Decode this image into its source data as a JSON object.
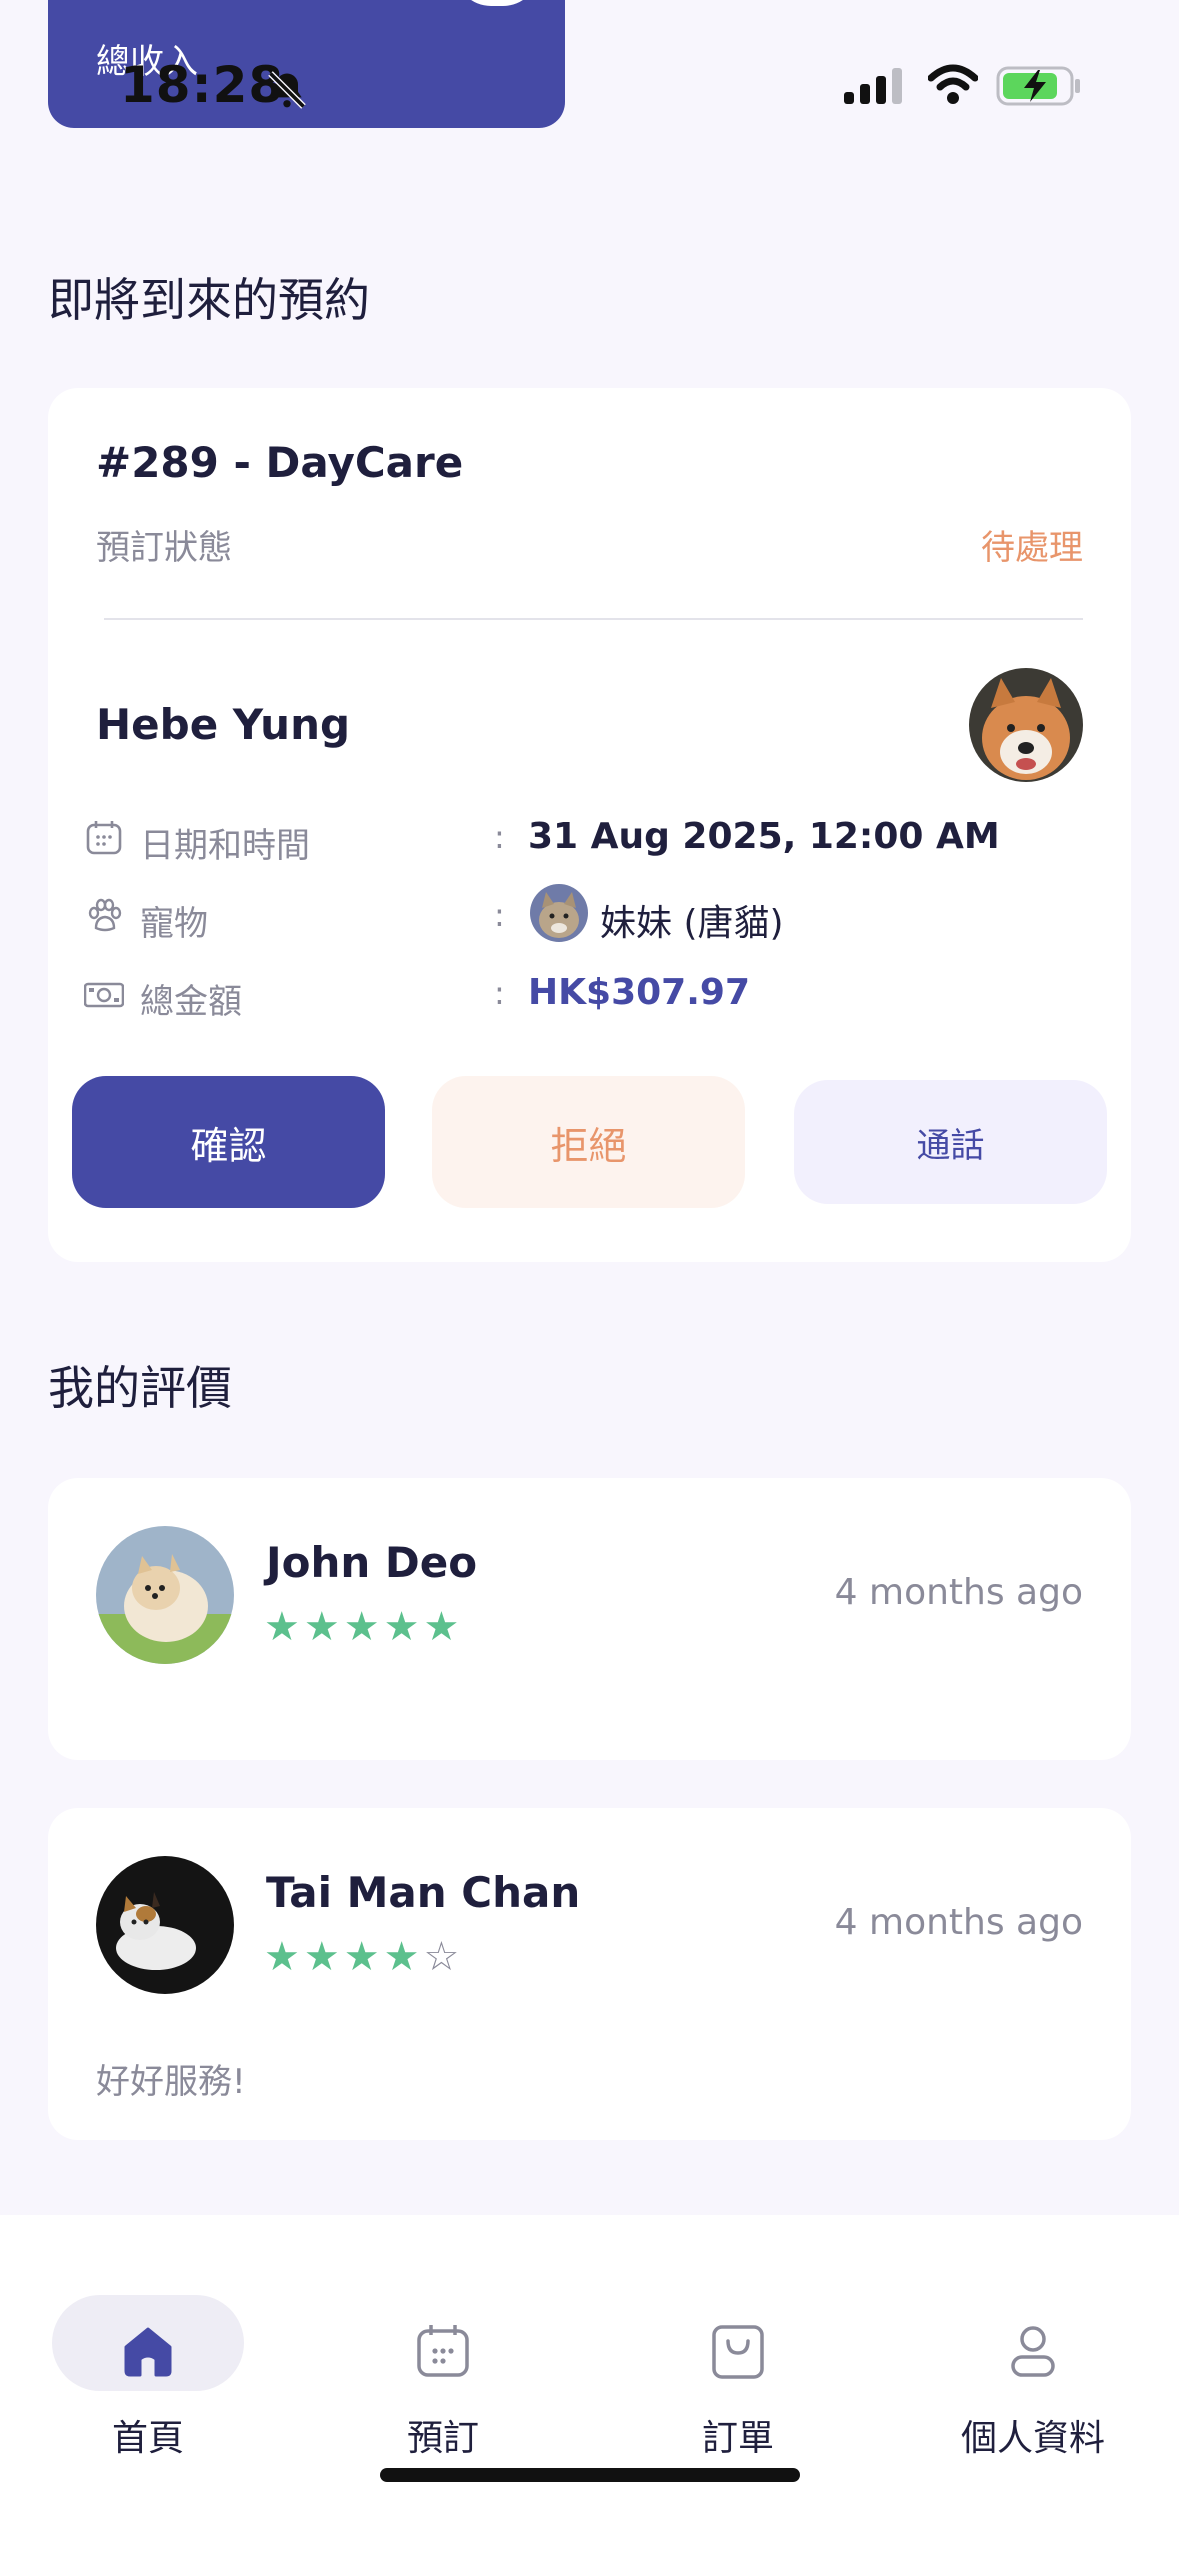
{
  "status_bar": {
    "time": "18:28"
  },
  "income_card": {
    "label": "總收入"
  },
  "upcoming": {
    "title": "即將到來的預約",
    "booking": {
      "id_title": "#289 - DayCare",
      "status_label": "預訂狀態",
      "status_value": "待處理",
      "customer_name": "Hebe Yung",
      "datetime_label": "日期和時間",
      "datetime_value": "31 Aug 2025, 12:00 AM",
      "pet_label": "寵物",
      "pet_value": "妹妹 (唐貓)",
      "total_label": "總金額",
      "total_value": "HK$307.97",
      "colon": ":",
      "confirm_label": "確認",
      "reject_label": "拒絕",
      "call_label": "通話"
    }
  },
  "reviews": {
    "title": "我的評價",
    "items": [
      {
        "name": "John Deo",
        "time": "4 months ago",
        "rating": 5,
        "stars": "★★★★★",
        "empty_stars": "",
        "comment": ""
      },
      {
        "name": "Tai Man Chan",
        "time": "4 months ago",
        "rating": 4,
        "stars": "★★★★",
        "empty_stars": "☆",
        "comment": "好好服務!"
      }
    ]
  },
  "nav": {
    "items": [
      {
        "label": "首頁",
        "icon": "home-icon",
        "active": true
      },
      {
        "label": "預訂",
        "icon": "calendar-icon",
        "active": false
      },
      {
        "label": "訂單",
        "icon": "shopping-bag-icon",
        "active": false
      },
      {
        "label": "個人資料",
        "icon": "user-icon",
        "active": false
      }
    ]
  },
  "colors": {
    "primary": "#454AA5",
    "pending": "#E8956B",
    "star": "#5CC08D",
    "background": "#F8F6FD"
  }
}
